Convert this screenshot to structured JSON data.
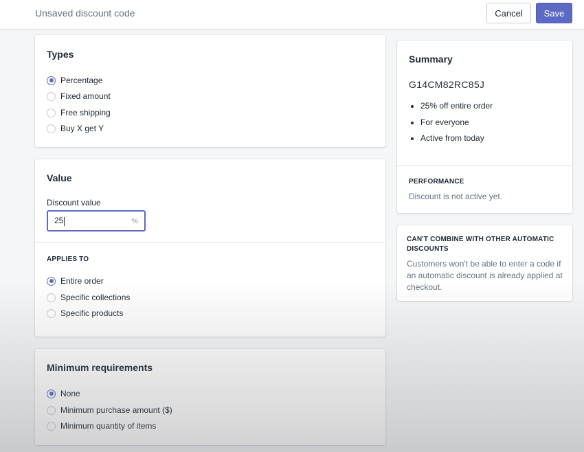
{
  "header": {
    "title": "Unsaved discount code",
    "cancel_label": "Cancel",
    "save_label": "Save"
  },
  "colors": {
    "accent": "#5c6ac4"
  },
  "types": {
    "title": "Types",
    "options": [
      {
        "label": "Percentage",
        "checked": true
      },
      {
        "label": "Fixed amount",
        "checked": false
      },
      {
        "label": "Free shipping",
        "checked": false
      },
      {
        "label": "Buy X get Y",
        "checked": false
      }
    ]
  },
  "value": {
    "title": "Value",
    "discount_label": "Discount value",
    "discount_value": "25",
    "discount_suffix": "%",
    "applies_to_title": "APPLIES TO",
    "applies_options": [
      {
        "label": "Entire order",
        "checked": true
      },
      {
        "label": "Specific collections",
        "checked": false
      },
      {
        "label": "Specific products",
        "checked": false
      }
    ]
  },
  "minimum": {
    "title": "Minimum requirements",
    "options": [
      {
        "label": "None",
        "checked": true
      },
      {
        "label": "Minimum purchase amount ($)",
        "checked": false
      },
      {
        "label": "Minimum quantity of items",
        "checked": false
      }
    ]
  },
  "summary": {
    "title": "Summary",
    "code": "G14CM82RC85J",
    "bullets": [
      "25% off entire order",
      "For everyone",
      "Active from today"
    ],
    "performance_title": "PERFORMANCE",
    "performance_text": "Discount is not active yet."
  },
  "notice": {
    "title": "CAN'T COMBINE WITH OTHER AUTOMATIC DISCOUNTS",
    "text": "Customers won't be able to enter a code if an automatic discount is already applied at checkout."
  }
}
